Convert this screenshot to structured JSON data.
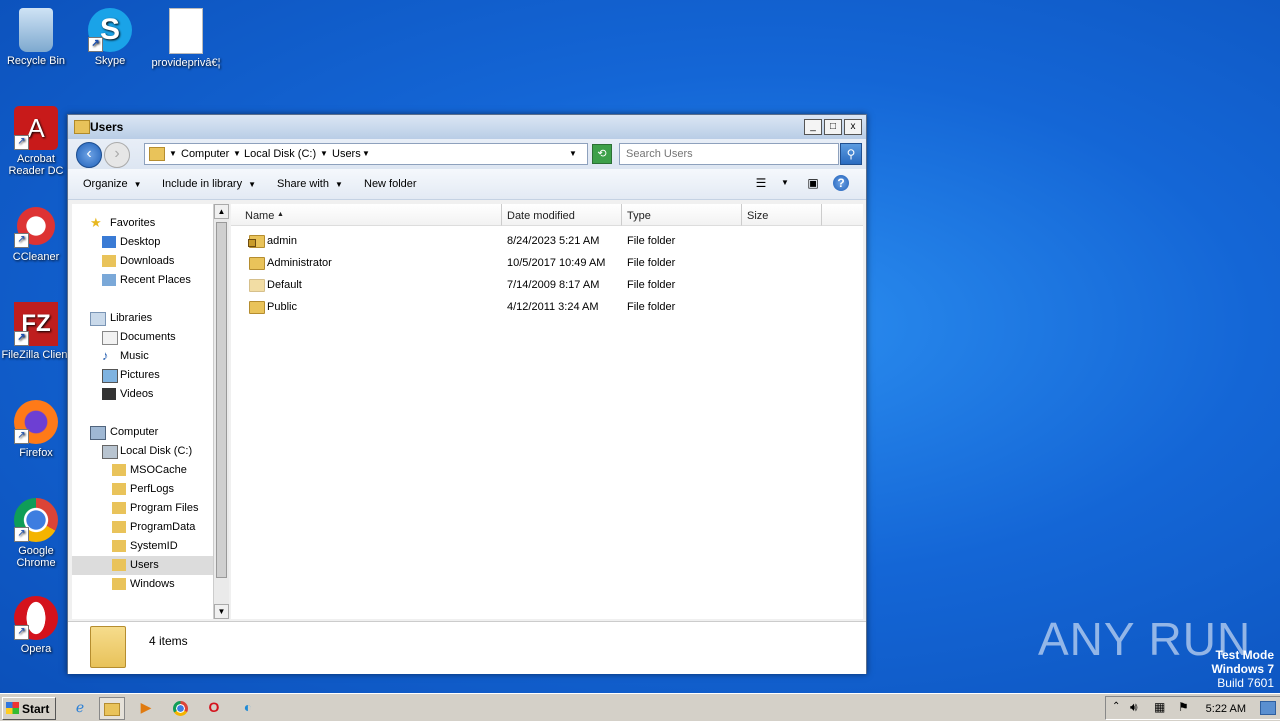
{
  "desktop": {
    "icons": [
      {
        "label": "Recycle Bin"
      },
      {
        "label": "Skype"
      },
      {
        "label": "provideprivâ€¦"
      },
      {
        "label": "Acrobat Reader DC"
      },
      {
        "label": "CCleaner"
      },
      {
        "label": "FileZilla Client"
      },
      {
        "label": "Firefox"
      },
      {
        "label": "Google Chrome"
      },
      {
        "label": "Opera"
      }
    ],
    "watermark": "ANY RUN",
    "testmode": {
      "line1": "Test Mode",
      "line2": "Windows 7",
      "line3": "Build 7601"
    }
  },
  "window": {
    "title": "Users",
    "controls": {
      "minimize": "_",
      "maximize": "□",
      "close": "x"
    },
    "address": {
      "crumb1": "Computer",
      "crumb2": "Local Disk (C:)",
      "crumb3": "Users"
    },
    "search_placeholder": "Search Users",
    "toolbar": {
      "organize": "Organize",
      "include": "Include in library",
      "share": "Share with",
      "newfolder": "New folder"
    },
    "nav": {
      "favorites": "Favorites",
      "desktop": "Desktop",
      "downloads": "Downloads",
      "recent": "Recent Places",
      "libraries": "Libraries",
      "documents": "Documents",
      "music": "Music",
      "pictures": "Pictures",
      "videos": "Videos",
      "computer": "Computer",
      "localdisk": "Local Disk (C:)",
      "msocache": "MSOCache",
      "perflogs": "PerfLogs",
      "programfiles": "Program Files",
      "programdata": "ProgramData",
      "systemid": "SystemID",
      "users": "Users",
      "windows": "Windows"
    },
    "columns": {
      "name": "Name",
      "date": "Date modified",
      "type": "Type",
      "size": "Size"
    },
    "files": [
      {
        "name": "admin",
        "date": "8/24/2023 5:21 AM",
        "type": "File folder"
      },
      {
        "name": "Administrator",
        "date": "10/5/2017 10:49 AM",
        "type": "File folder"
      },
      {
        "name": "Default",
        "date": "7/14/2009 8:17 AM",
        "type": "File folder"
      },
      {
        "name": "Public",
        "date": "4/12/2011 3:24 AM",
        "type": "File folder"
      }
    ],
    "status": "4 items"
  },
  "taskbar": {
    "start": "Start",
    "clock": "5:22 AM"
  }
}
